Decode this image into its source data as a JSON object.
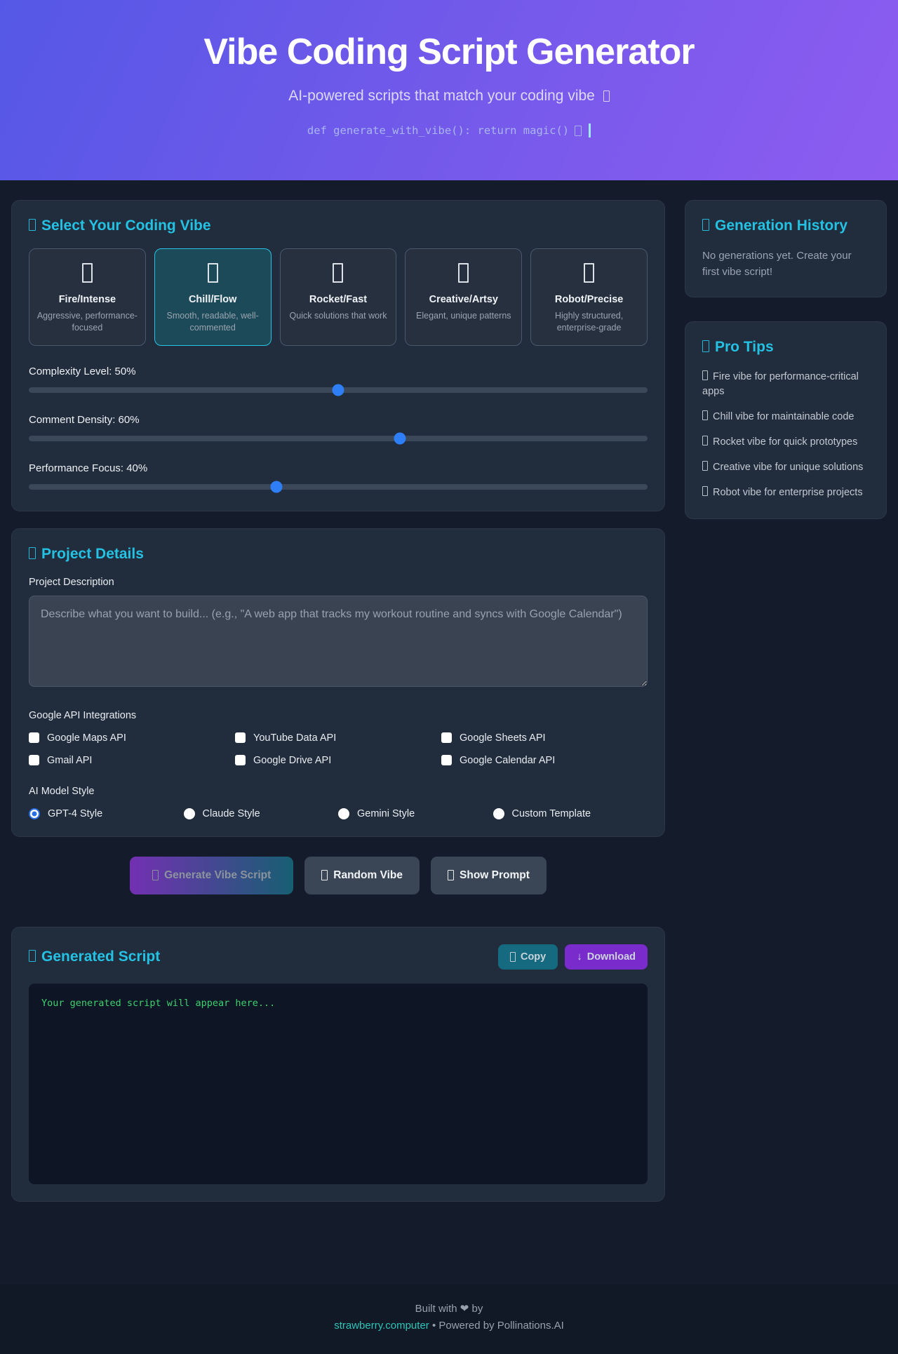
{
  "header": {
    "title": "Vibe Coding Script Generator",
    "subtitle": "AI-powered scripts that match your coding vibe",
    "code_snippet": "def generate_with_vibe(): return magic()"
  },
  "vibe_section": {
    "title": "Select Your Coding Vibe",
    "vibes": [
      {
        "name": "Fire/Intense",
        "desc": "Aggressive, performance-focused",
        "selected": false
      },
      {
        "name": "Chill/Flow",
        "desc": "Smooth, readable, well-commented",
        "selected": true
      },
      {
        "name": "Rocket/Fast",
        "desc": "Quick solutions that work",
        "selected": false
      },
      {
        "name": "Creative/Artsy",
        "desc": "Elegant, unique patterns",
        "selected": false
      },
      {
        "name": "Robot/Precise",
        "desc": "Highly structured, enterprise-grade",
        "selected": false
      }
    ],
    "sliders": [
      {
        "label": "Complexity Level: 50%",
        "value": 50
      },
      {
        "label": "Comment Density: 60%",
        "value": 60
      },
      {
        "label": "Performance Focus: 40%",
        "value": 40
      }
    ]
  },
  "project_section": {
    "title": "Project Details",
    "description_label": "Project Description",
    "description_placeholder": "Describe what you want to build... (e.g., \"A web app that tracks my workout routine and syncs with Google Calendar\")",
    "integrations_label": "Google API Integrations",
    "integrations": [
      {
        "label": "Google Maps API",
        "checked": false
      },
      {
        "label": "YouTube Data API",
        "checked": false
      },
      {
        "label": "Google Sheets API",
        "checked": false
      },
      {
        "label": "Gmail API",
        "checked": false
      },
      {
        "label": "Google Drive API",
        "checked": false
      },
      {
        "label": "Google Calendar API",
        "checked": false
      }
    ],
    "model_label": "AI Model Style",
    "models": [
      {
        "label": "GPT-4 Style",
        "selected": true
      },
      {
        "label": "Claude Style",
        "selected": false
      },
      {
        "label": "Gemini Style",
        "selected": false
      },
      {
        "label": "Custom Template",
        "selected": false
      }
    ]
  },
  "actions": {
    "generate": "Generate Vibe Script",
    "random": "Random Vibe",
    "show_prompt": "Show Prompt"
  },
  "output_section": {
    "title": "Generated Script",
    "copy": "Copy",
    "download": "Download",
    "download_arrow": "↓",
    "placeholder": "Your generated script will appear here..."
  },
  "sidebar": {
    "history": {
      "title": "Generation History",
      "empty": "No generations yet. Create your first vibe script!"
    },
    "tips": {
      "title": "Pro Tips",
      "items": [
        "Fire vibe for performance-critical apps",
        "Chill vibe for maintainable code",
        "Rocket vibe for quick prototypes",
        "Creative vibe for unique solutions",
        "Robot vibe for enterprise projects"
      ]
    }
  },
  "footer": {
    "line1_prefix": "Built with",
    "heart": "❤",
    "line1_suffix": "by",
    "link": "strawberry.computer",
    "powered": "• Powered by Pollinations.AI"
  },
  "colors": {
    "accent_cyan": "#25c1e3",
    "accent_blue": "#2e7ef6",
    "selected_vibe_bg": "#1d4a59",
    "copy_teal": "#166a80",
    "download_purple": "#792bcc",
    "link_teal": "#2ec4b6",
    "code_green": "#3ed16d",
    "header_gradient_start": "#5558e6",
    "header_gradient_end": "#8d5cf0"
  }
}
